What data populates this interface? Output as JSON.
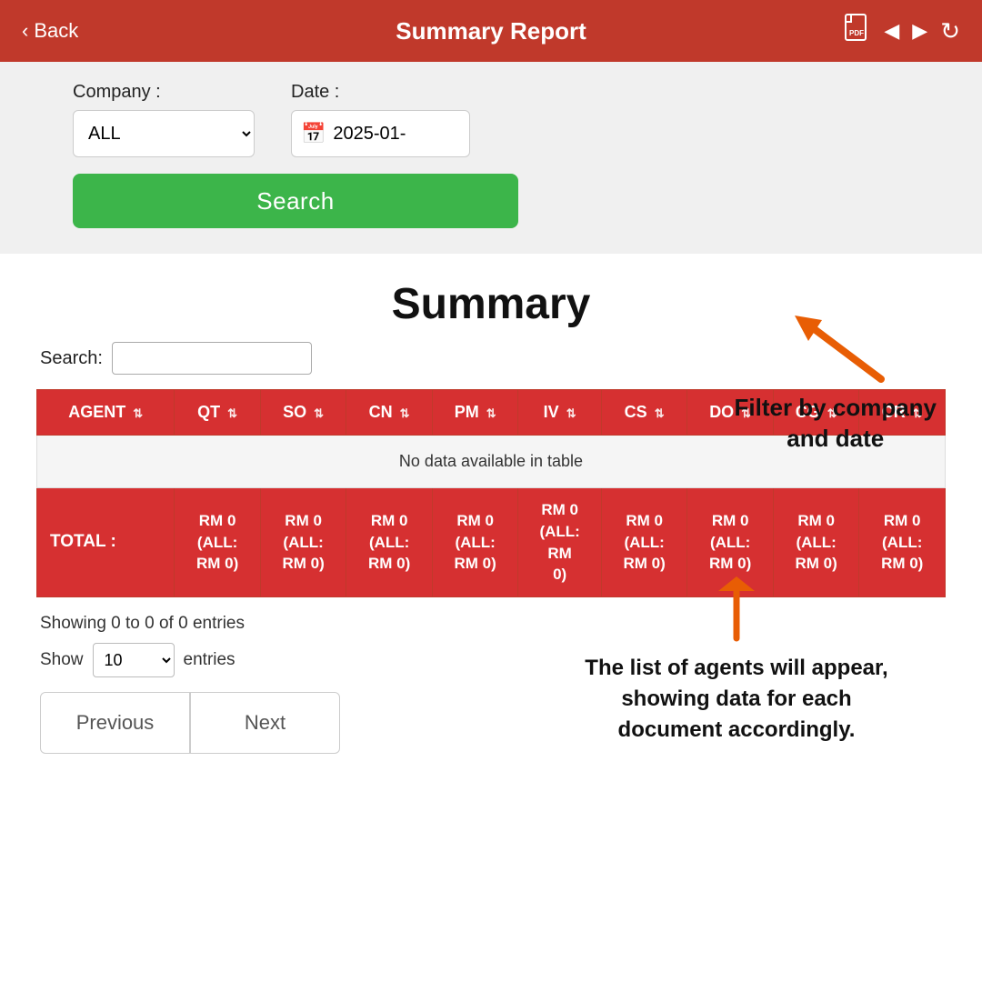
{
  "header": {
    "back_label": "Back",
    "title": "Summary Report",
    "pdf_icon": "📄",
    "prev_icon": "◀",
    "next_icon": "▶",
    "refresh_icon": "↻"
  },
  "filter": {
    "company_label": "Company :",
    "company_value": "ALL",
    "company_options": [
      "ALL"
    ],
    "date_label": "Date :",
    "date_value": "2025-01-",
    "search_button": "Search"
  },
  "summary": {
    "title": "Summary",
    "search_label": "Search:",
    "search_placeholder": ""
  },
  "table": {
    "columns": [
      {
        "key": "agent",
        "label": "AGENT",
        "sortable": true
      },
      {
        "key": "qt",
        "label": "QT",
        "sortable": true
      },
      {
        "key": "so",
        "label": "SO",
        "sortable": true
      },
      {
        "key": "cn",
        "label": "CN",
        "sortable": true
      },
      {
        "key": "pm",
        "label": "PM",
        "sortable": true
      },
      {
        "key": "iv",
        "label": "IV",
        "sortable": true
      },
      {
        "key": "cs",
        "label": "CS",
        "sortable": true
      },
      {
        "key": "do",
        "label": "DO",
        "sortable": true
      },
      {
        "key": "cg",
        "label": "CG",
        "sortable": true
      },
      {
        "key": "cr",
        "label": "CR",
        "sortable": true
      }
    ],
    "no_data_text": "No data available in table",
    "total_label": "TOTAL :",
    "total_values": [
      "RM 0\n(ALL:\nRM 0)",
      "RM 0\n(ALL:\nRM 0)",
      "RM 0\n(ALL:\nRM 0)",
      "RM 0\n(ALL:\nRM 0)",
      "RM 0\n(ALL:\nRM\n0)",
      "RM 0\n(ALL:\nRM 0)",
      "RM 0\n(ALL:\nRM 0)",
      "RM 0\n(ALL:\nRM 0)",
      "RM 0\n(ALL:\nRM 0)"
    ]
  },
  "pagination": {
    "showing_text": "Showing 0 to 0 of 0 entries",
    "show_label": "Show",
    "show_value": "10",
    "entries_label": "entries",
    "previous_button": "Previous",
    "next_button": "Next"
  },
  "annotations": {
    "filter_label": "Filter by company\nand date",
    "agents_label": "The list of agents will appear,\nshowing data for each\ndocument accordingly."
  }
}
